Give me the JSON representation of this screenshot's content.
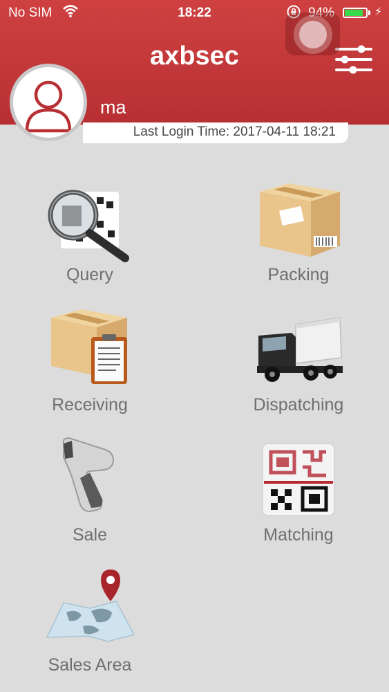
{
  "status_bar": {
    "carrier": "No SIM",
    "time": "18:22",
    "battery": "94%",
    "battery_level": 0.94
  },
  "header": {
    "title": "axbsec"
  },
  "user": {
    "name": "ma",
    "last_login": "Last Login Time: 2017-04-11 18:21"
  },
  "menu": {
    "query": "Query",
    "packing": "Packing",
    "receiving": "Receiving",
    "dispatching": "Dispatching",
    "sale": "Sale",
    "matching": "Matching",
    "sales_area": "Sales Area"
  },
  "colors": {
    "header": "#c23a3c",
    "accent": "#b82f33",
    "background": "#dcdcdc",
    "battery": "#37d84a"
  },
  "icons": [
    "wifi-icon",
    "lock-rotation-icon",
    "battery-icon",
    "charging-icon",
    "assistive-touch-icon",
    "settings-sliders-icon",
    "user-avatar-icon",
    "query-magnifier-icon",
    "packing-box-icon",
    "receiving-clipboard-icon",
    "dispatching-truck-icon",
    "sale-scanner-icon",
    "matching-qr-icon",
    "sales-area-map-icon"
  ]
}
